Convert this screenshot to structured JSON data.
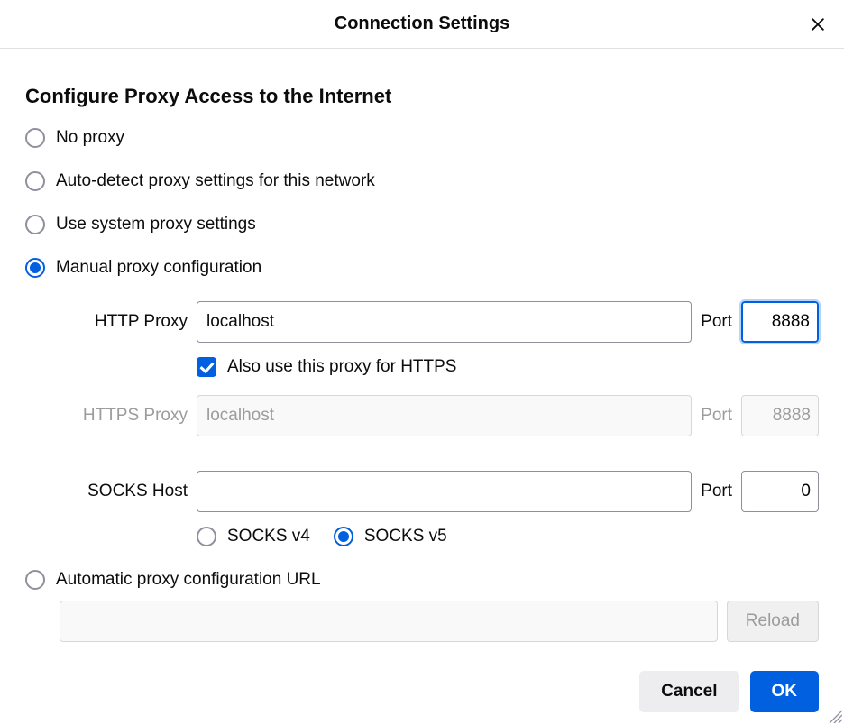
{
  "dialog": {
    "title": "Connection Settings",
    "section_title": "Configure Proxy Access to the Internet"
  },
  "proxy_options": {
    "no_proxy": {
      "label": "No proxy",
      "checked": false
    },
    "auto_detect": {
      "label": "Auto-detect proxy settings for this network",
      "checked": false
    },
    "system": {
      "label": "Use system proxy settings",
      "checked": false
    },
    "manual": {
      "label": "Manual proxy configuration",
      "checked": true
    },
    "pac": {
      "label": "Automatic proxy configuration URL",
      "checked": false
    }
  },
  "manual": {
    "http": {
      "label": "HTTP Proxy",
      "host": "localhost",
      "port_label": "Port",
      "port": "8888"
    },
    "also_https": {
      "label": "Also use this proxy for HTTPS",
      "checked": true
    },
    "https": {
      "label": "HTTPS Proxy",
      "host": "localhost",
      "port_label": "Port",
      "port": "8888",
      "disabled": true
    },
    "socks": {
      "label": "SOCKS Host",
      "host": "",
      "port_label": "Port",
      "port": "0"
    },
    "socks_version": {
      "v4": {
        "label": "SOCKS v4",
        "checked": false
      },
      "v5": {
        "label": "SOCKS v5",
        "checked": true
      }
    }
  },
  "pac": {
    "url": "",
    "reload_label": "Reload",
    "disabled": true
  },
  "buttons": {
    "cancel": "Cancel",
    "ok": "OK"
  }
}
